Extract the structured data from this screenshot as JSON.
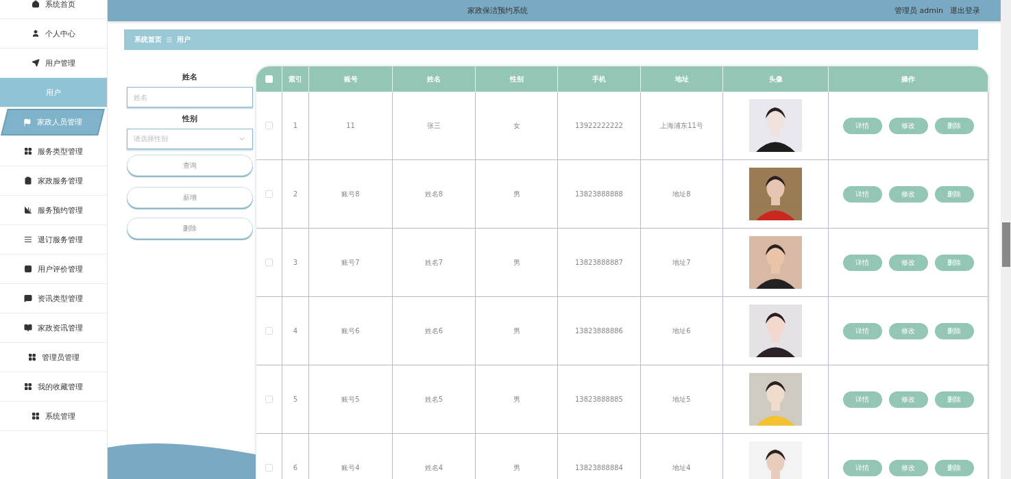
{
  "header": {
    "title": "家政保洁预约系统",
    "user": "管理员 admin",
    "logout": "退出登录"
  },
  "sidebar": {
    "items": [
      {
        "label": "系统首页",
        "kind": "menu",
        "selected": false,
        "hovered": false
      },
      {
        "label": "个人中心",
        "kind": "menu",
        "selected": false,
        "hovered": false
      },
      {
        "label": "用户管理",
        "kind": "menu",
        "selected": false,
        "hovered": false
      },
      {
        "label": "用户",
        "kind": "submenu",
        "selected": true,
        "hovered": false
      },
      {
        "label": "家政人员管理",
        "kind": "menu",
        "selected": false,
        "hovered": true
      },
      {
        "label": "服务类型管理",
        "kind": "menu",
        "selected": false,
        "hovered": false
      },
      {
        "label": "家政服务管理",
        "kind": "menu",
        "selected": false,
        "hovered": false
      },
      {
        "label": "服务预约管理",
        "kind": "menu",
        "selected": false,
        "hovered": false
      },
      {
        "label": "退订服务管理",
        "kind": "menu",
        "selected": false,
        "hovered": false
      },
      {
        "label": "用户评价管理",
        "kind": "menu",
        "selected": false,
        "hovered": false
      },
      {
        "label": "资讯类型管理",
        "kind": "menu",
        "selected": false,
        "hovered": false
      },
      {
        "label": "家政资讯管理",
        "kind": "menu",
        "selected": false,
        "hovered": false
      },
      {
        "label": "管理员管理",
        "kind": "menu",
        "selected": false,
        "hovered": false
      },
      {
        "label": "我的收藏管理",
        "kind": "menu",
        "selected": false,
        "hovered": false
      },
      {
        "label": "系统管理",
        "kind": "menu",
        "selected": false,
        "hovered": false
      }
    ]
  },
  "breadcrumb": [
    "系统首页",
    "用户"
  ],
  "search": {
    "fields": [
      {
        "label": "姓名",
        "kind": "input",
        "placeholder": "姓名"
      },
      {
        "label": "性别",
        "kind": "select",
        "placeholder": "请选择性别"
      }
    ],
    "buttons": [
      "查询",
      "新增",
      "删除"
    ]
  },
  "table": {
    "header_checked": false,
    "columns": [
      "索引",
      "账号",
      "姓名",
      "性别",
      "手机",
      "地址",
      "头像",
      "操作"
    ],
    "rows": [
      {
        "checked": false,
        "index": "1",
        "account": "11",
        "name": "张三",
        "gender": "女",
        "phone": "13922222222",
        "address": "上海浦东11号",
        "actions": [
          "详情",
          "修改",
          "删除"
        ]
      },
      {
        "checked": false,
        "index": "2",
        "account": "账号8",
        "name": "姓名8",
        "gender": "男",
        "phone": "13823888888",
        "address": "地址8",
        "actions": [
          "详情",
          "修改",
          "删除"
        ]
      },
      {
        "checked": false,
        "index": "3",
        "account": "账号7",
        "name": "姓名7",
        "gender": "男",
        "phone": "13823888887",
        "address": "地址7",
        "actions": [
          "详情",
          "修改",
          "删除"
        ]
      },
      {
        "checked": false,
        "index": "4",
        "account": "账号6",
        "name": "姓名6",
        "gender": "男",
        "phone": "13823888886",
        "address": "地址6",
        "actions": [
          "详情",
          "修改",
          "删除"
        ]
      },
      {
        "checked": false,
        "index": "5",
        "account": "账号5",
        "name": "姓名5",
        "gender": "男",
        "phone": "13823888885",
        "address": "地址5",
        "actions": [
          "详情",
          "修改",
          "删除"
        ]
      },
      {
        "checked": false,
        "index": "6",
        "account": "账号4",
        "name": "姓名4",
        "gender": "男",
        "phone": "13823888884",
        "address": "地址4",
        "actions": [
          "详情",
          "修改",
          "删除"
        ]
      }
    ]
  }
}
